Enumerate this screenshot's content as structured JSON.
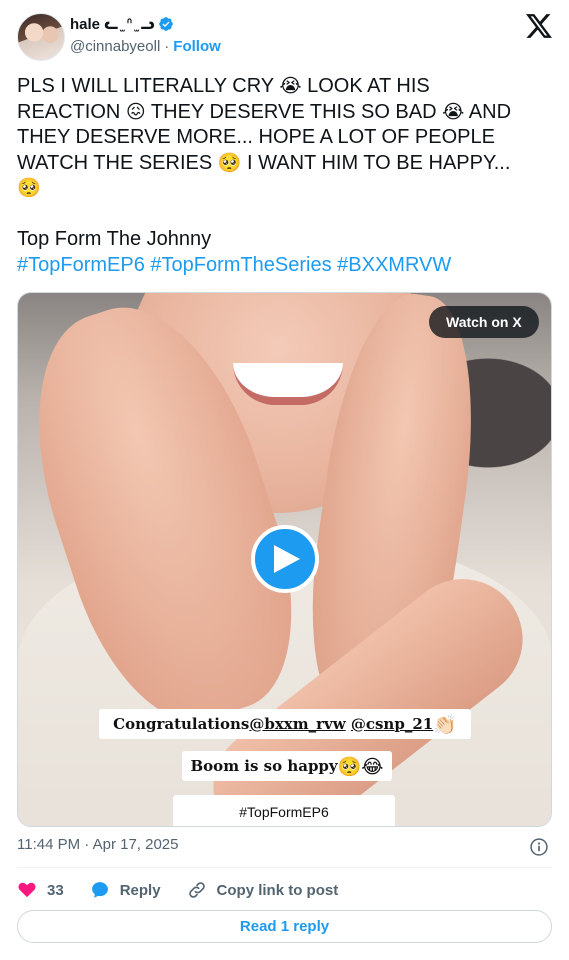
{
  "author": {
    "name": "hale ᓚ ̫̫ ᐢ ̫̫ ᓗ",
    "handle": "@cinnabyeoll",
    "separator": "·",
    "follow_label": "Follow",
    "verified": true
  },
  "tweet": {
    "text_line1": "PLS I WILL LITERALLY CRY ",
    "emoji1": "😭",
    "text_line1b": " LOOK AT HIS",
    "text_line2a": "REACTION ",
    "emoji2": "😖",
    "text_line2b": " THEY DESERVE THIS SO BAD ",
    "emoji3": "😭",
    "text_line2c": " AND",
    "text_line3": "THEY DESERVE MORE... HOPE A LOT OF PEOPLE",
    "text_line4a": "WATCH THE SERIES ",
    "emoji4": "🥺",
    "text_line4b": " I WANT HIM TO BE HAPPY...",
    "emoji5": "🥺",
    "subtitle": "Top Form The Johnny",
    "hashtags": [
      "#TopFormEP6",
      "#TopFormTheSeries",
      "#BXXMRVW"
    ]
  },
  "media": {
    "watch_label": "Watch on X",
    "caption1_prefix": "Congratulations ",
    "caption1_mention1": "@bxxm_rvw",
    "caption1_mention2": "@csnp_21",
    "caption1_emoji": "👏🏻",
    "caption2": "Boom is so happy",
    "caption2_emoji": "🥺😂",
    "caption3": "#TopFormEP6"
  },
  "timestamp": "11:44 PM · Apr 17, 2025",
  "actions": {
    "like_count": "33",
    "reply_label": "Reply",
    "copy_label": "Copy link to post"
  },
  "read_reply_label": "Read 1 reply",
  "colors": {
    "accent": "#1d9bf0",
    "like": "#f91880",
    "secondary_text": "#536471"
  },
  "icons": [
    "verified-badge-icon",
    "x-logo-icon",
    "play-icon",
    "info-icon",
    "heart-icon",
    "reply-bubble-icon",
    "link-icon"
  ]
}
